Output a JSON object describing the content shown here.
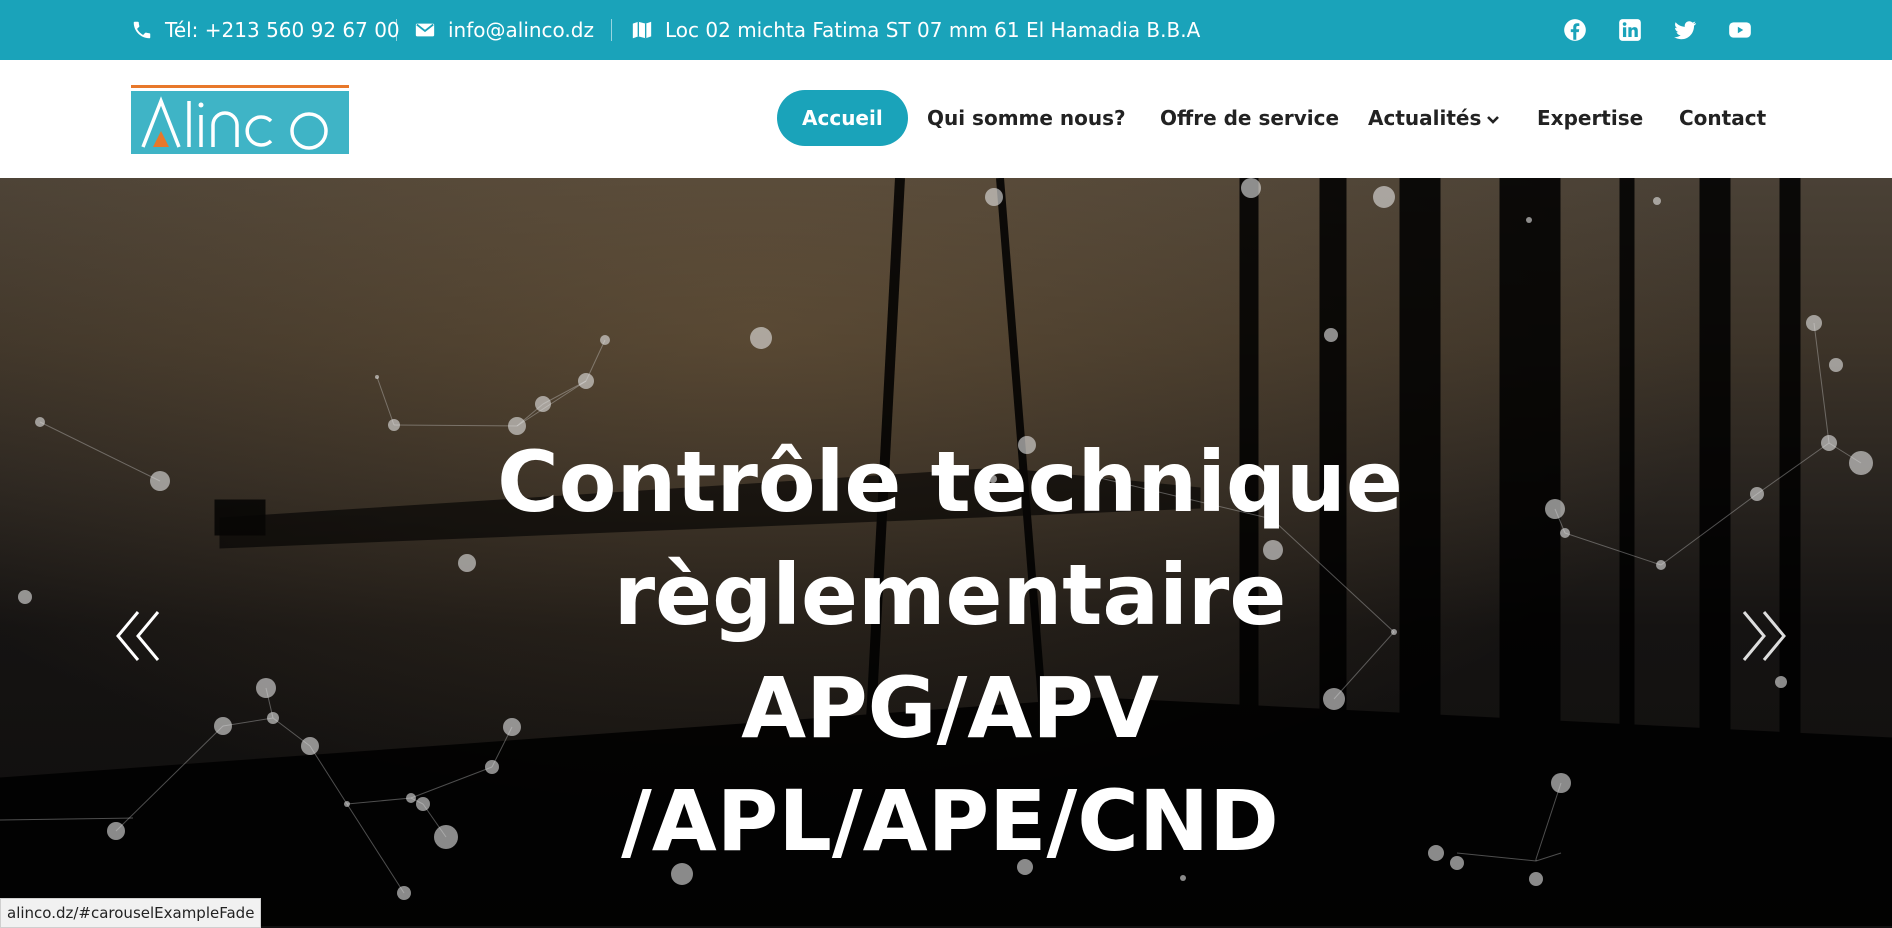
{
  "topbar": {
    "phone": "Tél: +213 560 92 67 00",
    "email": "info@alinco.dz",
    "address": "Loc 02 michta Fatima ST 07 mm 61 El Hamadia B.B.A",
    "icons": [
      "phone-icon",
      "envelope-icon",
      "map-icon"
    ],
    "social": [
      "facebook-icon",
      "linkedin-icon",
      "twitter-icon",
      "youtube-icon"
    ]
  },
  "header": {
    "logo_text": "Alinco",
    "nav": [
      {
        "label": "Accueil",
        "active": true
      },
      {
        "label": "Qui somme nous?"
      },
      {
        "label": "Offre de service"
      },
      {
        "label": "Actualités"
      },
      {
        "label": "Expertise"
      },
      {
        "label": "Contact"
      }
    ]
  },
  "hero": {
    "title_lines": [
      "Contrôle technique",
      "règlementaire",
      "APG/APV",
      "/APL/APE/CND"
    ],
    "prev_icon": "chevrons-left-icon",
    "next_icon": "chevrons-right-icon"
  },
  "status": {
    "url": "alinco.dz/#carouselExampleFade"
  },
  "colors": {
    "accent": "#1aa3ba",
    "logo_orange": "#e8782a",
    "logo_teal": "#3fb4c6"
  }
}
